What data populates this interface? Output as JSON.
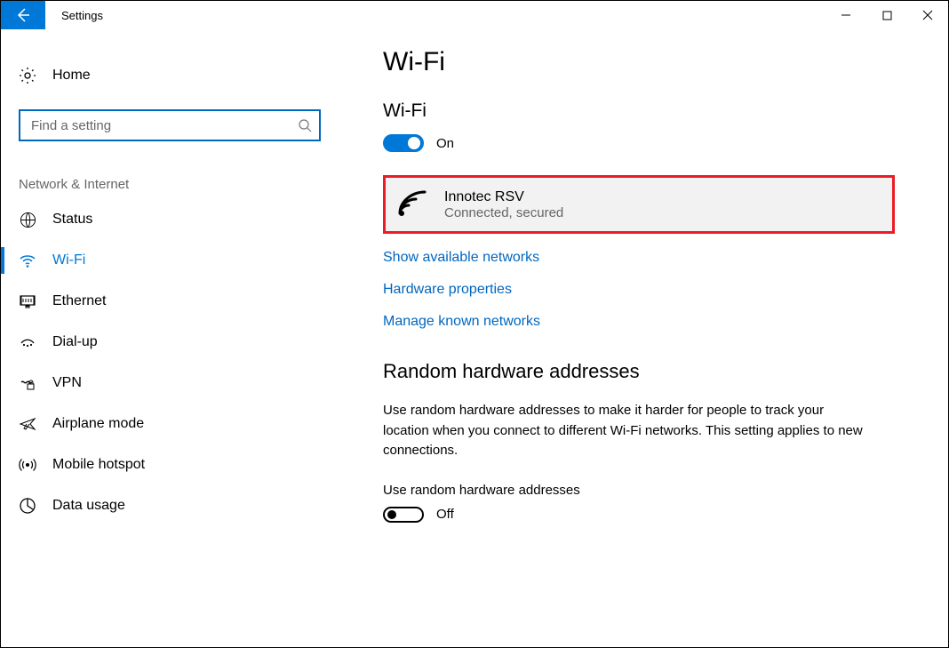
{
  "window": {
    "title": "Settings"
  },
  "sidebar": {
    "home": "Home",
    "search_placeholder": "Find a setting",
    "category": "Network & Internet",
    "items": [
      {
        "label": "Status"
      },
      {
        "label": "Wi-Fi"
      },
      {
        "label": "Ethernet"
      },
      {
        "label": "Dial-up"
      },
      {
        "label": "VPN"
      },
      {
        "label": "Airplane mode"
      },
      {
        "label": "Mobile hotspot"
      },
      {
        "label": "Data usage"
      }
    ]
  },
  "content": {
    "title": "Wi-Fi",
    "wifi_section_label": "Wi-Fi",
    "wifi_toggle_state": "On",
    "network": {
      "name": "Innotec RSV",
      "status": "Connected, secured"
    },
    "links": {
      "show_available": "Show available networks",
      "hardware_props": "Hardware properties",
      "manage_known": "Manage known networks"
    },
    "random_section": {
      "heading": "Random hardware addresses",
      "description": "Use random hardware addresses to make it harder for people to track your location when you connect to different Wi-Fi networks. This setting applies to new connections.",
      "toggle_label": "Use random hardware addresses",
      "toggle_state": "Off"
    }
  }
}
